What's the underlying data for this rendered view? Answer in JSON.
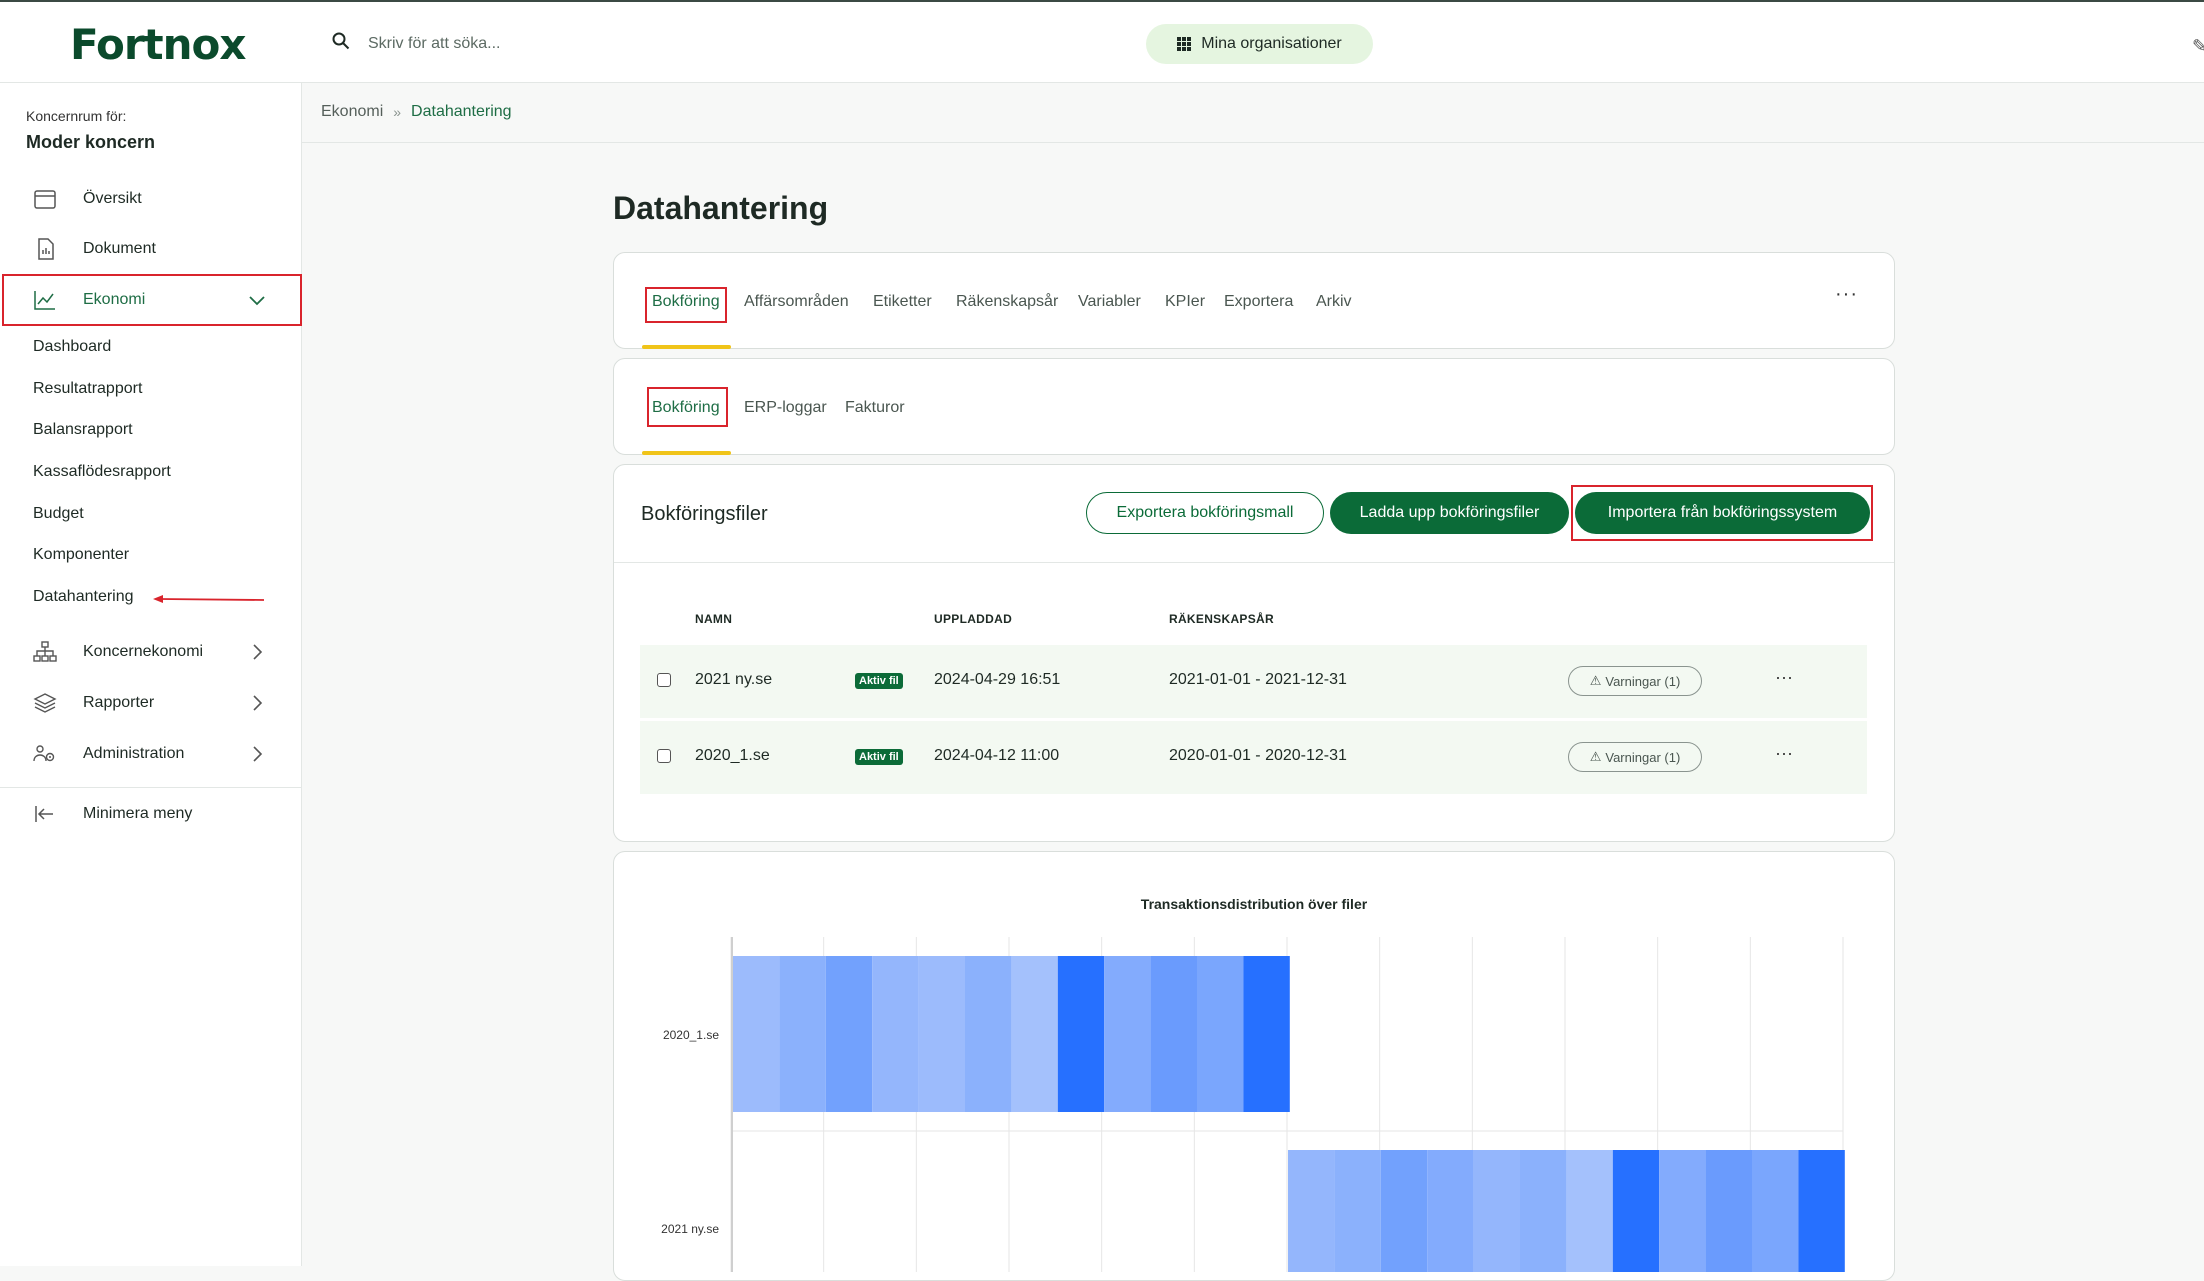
{
  "topbar": {
    "logo": "Fortnox",
    "search_placeholder": "Skriv för att söka...",
    "org_button": "Mina organisationer"
  },
  "sidebar": {
    "label": "Koncernrum för:",
    "org": "Moder koncern",
    "items": [
      {
        "label": "Översikt",
        "icon": "calendar-icon"
      },
      {
        "label": "Dokument",
        "icon": "document-icon"
      },
      {
        "label": "Ekonomi",
        "icon": "chart-line-icon"
      }
    ],
    "sub_items": [
      "Dashboard",
      "Resultatrapport",
      "Balansrapport",
      "Kassaflödesrapport",
      "Budget",
      "Komponenter",
      "Datahantering"
    ],
    "items2": [
      {
        "label": "Koncernekonomi",
        "icon": "hierarchy-icon"
      },
      {
        "label": "Rapporter",
        "icon": "layers-icon"
      },
      {
        "label": "Administration",
        "icon": "users-gear-icon"
      }
    ],
    "minimize": "Minimera meny"
  },
  "breadcrumb": {
    "parent": "Ekonomi",
    "separator": "»",
    "current": "Datahantering"
  },
  "page": {
    "title": "Datahantering"
  },
  "tabs_main": [
    "Bokföring",
    "Affärsområden",
    "Etiketter",
    "Räkenskapsår",
    "Variabler",
    "KPIer",
    "Exportera",
    "Arkiv"
  ],
  "tabs_sub": [
    "Bokföring",
    "ERP-loggar",
    "Fakturor"
  ],
  "files": {
    "title": "Bokföringsfiler",
    "buttons": {
      "export": "Exportera bokföringsmall",
      "upload": "Ladda upp bokföringsfiler",
      "import": "Importera från bokföringssystem"
    },
    "headers": {
      "name": "NAMN",
      "uploaded": "UPPLADDAD",
      "fiscal_year": "RÄKENSKAPSÅR"
    },
    "rows": [
      {
        "name": "2021 ny.se",
        "badge": "Aktiv fil",
        "uploaded": "2024-04-29 16:51",
        "fiscal_year": "2021-01-01 - 2021-12-31",
        "warnings": "Varningar (1)"
      },
      {
        "name": "2020_1.se",
        "badge": "Aktiv fil",
        "uploaded": "2024-04-12 11:00",
        "fiscal_year": "2020-01-01 - 2020-12-31",
        "warnings": "Varningar (1)"
      }
    ]
  },
  "chart_data": {
    "type": "heatmap",
    "title": "Transaktionsdistribution över filer",
    "categories": [
      "2020_1.se",
      "2021 ny.se"
    ],
    "series": [
      {
        "values": [
          0.25,
          0.35,
          0.5,
          0.3,
          0.25,
          0.35,
          0.2,
          0.95,
          0.4,
          0.55,
          0.45,
          0.95
        ]
      },
      {
        "values": [
          0.3,
          0.35,
          0.5,
          0.4,
          0.3,
          0.35,
          0.2,
          0.95,
          0.4,
          0.55,
          0.45,
          0.95
        ]
      }
    ],
    "colors": {
      "low": "#c6d6fb",
      "high": "#1e6bff"
    },
    "grid": true
  }
}
